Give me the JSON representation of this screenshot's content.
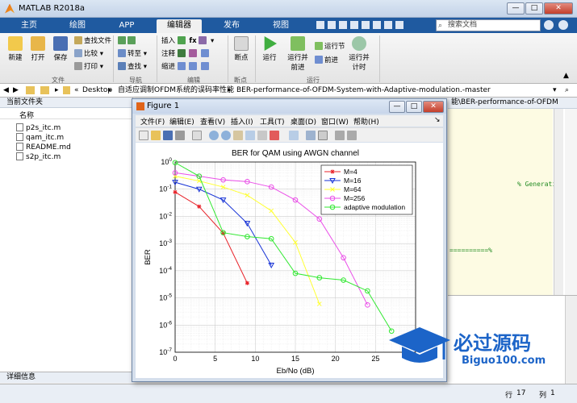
{
  "window": {
    "title": "MATLAB R2018a"
  },
  "tabs": [
    "主页",
    "绘图",
    "APP",
    "编辑器",
    "发布",
    "视图"
  ],
  "active_tab": 3,
  "search": {
    "placeholder": "搜索文档"
  },
  "toolstrip": {
    "file_group": {
      "new": "新建",
      "open": "打开",
      "save": "保存",
      "find_file": "查找文件",
      "compare": "比较",
      "print": "打印",
      "label": "文件"
    },
    "nav_group": {
      "goto": "转至",
      "find": "查找",
      "label": "导航"
    },
    "edit_group": {
      "insert": "插入",
      "comment": "注释",
      "indent": "缩进",
      "label": "编辑"
    },
    "breakpoint_group": {
      "breakpoints": "断点",
      "label": "断点"
    },
    "run_group": {
      "run": "运行",
      "run_advance_1": "运行并",
      "run_advance_2": "前进",
      "run_section": "运行节",
      "advance": "前进",
      "run_time_1": "运行并",
      "run_time_2": "计时",
      "label": "运行"
    }
  },
  "address": {
    "path": [
      "Desktop",
      "自适应调制OFDM系统的误码率性能",
      "BER-performance-of-OFDM-System-with-Adaptive-modulation.-master"
    ]
  },
  "left_panel": {
    "header": "当前文件夹",
    "column": "名称",
    "files": [
      "p2s_itc.m",
      "qam_itc.m",
      "README.md",
      "s2p_itc.m"
    ],
    "details": "详细信息"
  },
  "editor": {
    "path_fragment": "能\\BER-performance-of-OFDM",
    "comment": "% Generati",
    "separator": "==========%"
  },
  "status": {
    "row_label": "行",
    "row": "17",
    "col_label": "列",
    "col": "1"
  },
  "figure": {
    "title": "Figure 1",
    "menu": [
      "文件(F)",
      "编辑(E)",
      "查看(V)",
      "插入(I)",
      "工具(T)",
      "桌面(D)",
      "窗口(W)",
      "帮助(H)"
    ]
  },
  "watermark": {
    "title": "必过源码",
    "url": "Biguo100.com"
  },
  "colors": {
    "tab_bar": "#1f5aa0",
    "m4": "#e8232a",
    "m16": "#1531d6",
    "m64": "#ffff33",
    "m256": "#ea4ee8",
    "adaptive": "#31e831"
  },
  "chart_data": {
    "type": "line",
    "title": "BER for QAM using AWGN channel",
    "xlabel": "Eb/No (dB)",
    "ylabel": "BER",
    "xlim": [
      0,
      30
    ],
    "ylim_log10": [
      -7,
      0
    ],
    "log_y": true,
    "grid": true,
    "legend_position": "top-right",
    "xticks": [
      "0",
      "5",
      "10",
      "15",
      "20",
      "25",
      "30"
    ],
    "yticks": [
      "10^0",
      "10^-1",
      "10^-2",
      "10^-3",
      "10^-4",
      "10^-5",
      "10^-6",
      "10^-7"
    ],
    "series": [
      {
        "name": "M=4",
        "color": "#e8232a",
        "marker": "star",
        "x": [
          0,
          3,
          6,
          9
        ],
        "y": [
          0.078,
          0.023,
          0.0024,
          3.5e-05
        ]
      },
      {
        "name": "M=16",
        "color": "#1531d6",
        "marker": "triangle-down",
        "x": [
          0,
          3,
          6,
          9,
          12
        ],
        "y": [
          0.18,
          0.1,
          0.04,
          0.0055,
          0.00016
        ]
      },
      {
        "name": "M=64",
        "color": "#ffff33",
        "marker": "x",
        "x": [
          0,
          3,
          6,
          9,
          12,
          15,
          18
        ],
        "y": [
          0.3,
          0.2,
          0.12,
          0.06,
          0.016,
          0.0011,
          6e-06
        ]
      },
      {
        "name": "M=256",
        "color": "#ea4ee8",
        "marker": "circle",
        "x": [
          0,
          3,
          6,
          9,
          12,
          15,
          18,
          21,
          24
        ],
        "y": [
          0.4,
          0.3,
          0.22,
          0.19,
          0.12,
          0.04,
          0.008,
          0.0003,
          5.5e-06
        ]
      },
      {
        "name": "adaptive modulation",
        "color": "#31e831",
        "marker": "circle",
        "x": [
          0,
          3,
          6,
          9,
          12,
          15,
          18,
          21,
          24,
          27
        ],
        "y": [
          0.95,
          0.3,
          0.0025,
          0.0018,
          0.0015,
          8e-05,
          5.5e-05,
          4.5e-05,
          1.8e-05,
          6e-07
        ]
      }
    ]
  }
}
